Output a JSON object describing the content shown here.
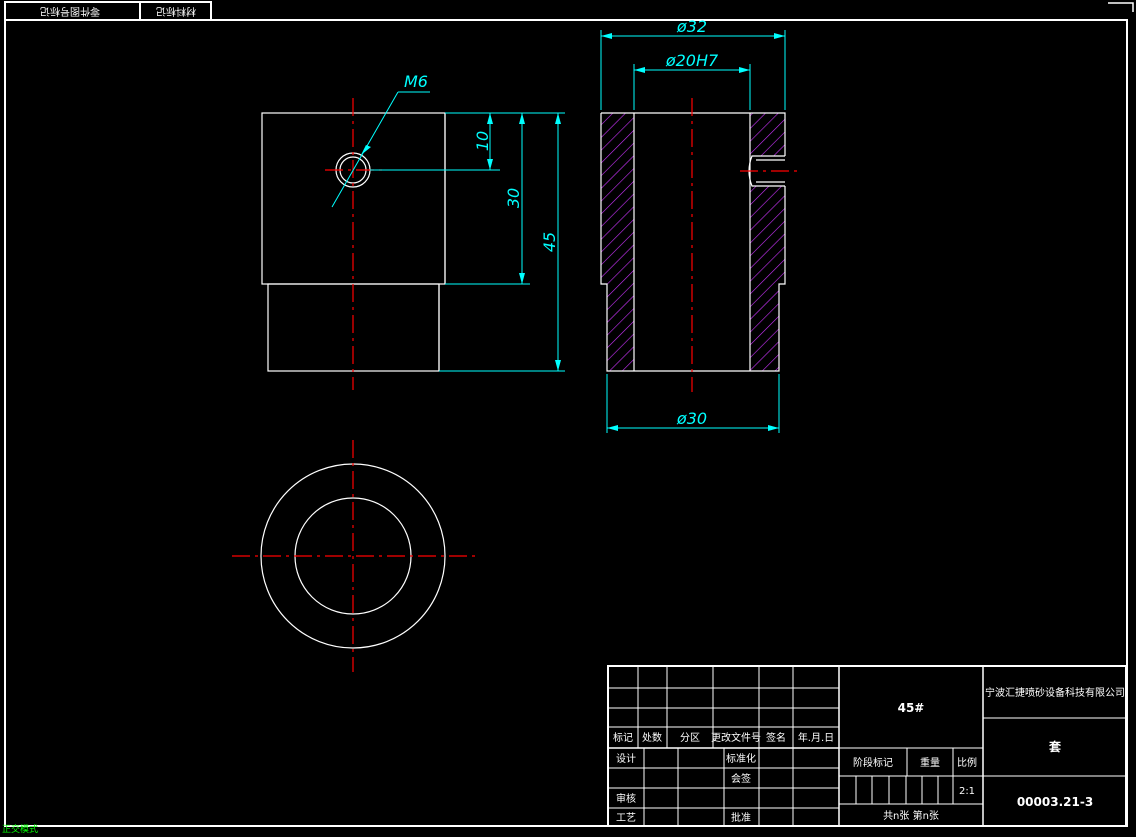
{
  "drawing": {
    "colors": {
      "background": "#000000",
      "outline": "#ffffff",
      "dimension": "#00ffff",
      "centerline": "#ff0000",
      "hatch": "#cc33ff",
      "status": "#00ff00"
    },
    "top_boxes": [
      "零件图号标记",
      "材料标记"
    ],
    "dimensions": {
      "thread": "M6",
      "d_outer_top": "ø32",
      "d_bore": "ø20H7",
      "d_outer_bottom": "ø30",
      "h_10": "10",
      "h_30": "30",
      "h_45": "45"
    },
    "title_block": {
      "headers": [
        "标记",
        "处数",
        "分区",
        "更改文件号",
        "签名",
        "年.月.日"
      ],
      "design": "设计",
      "standard": "标准化",
      "stage_mark": "阶段标记",
      "weight": "重量",
      "scale_label": "比例",
      "signed": "会签",
      "review": "审核",
      "process": "工艺",
      "approve": "批准",
      "sheets": "共n张 第n张",
      "material": "45#",
      "company": "宁波汇捷喷砂设备科技有限公司",
      "part_name": "套",
      "scale": "2:1",
      "drawing_no": "00003.21-3"
    },
    "status_text": "正交模式"
  }
}
